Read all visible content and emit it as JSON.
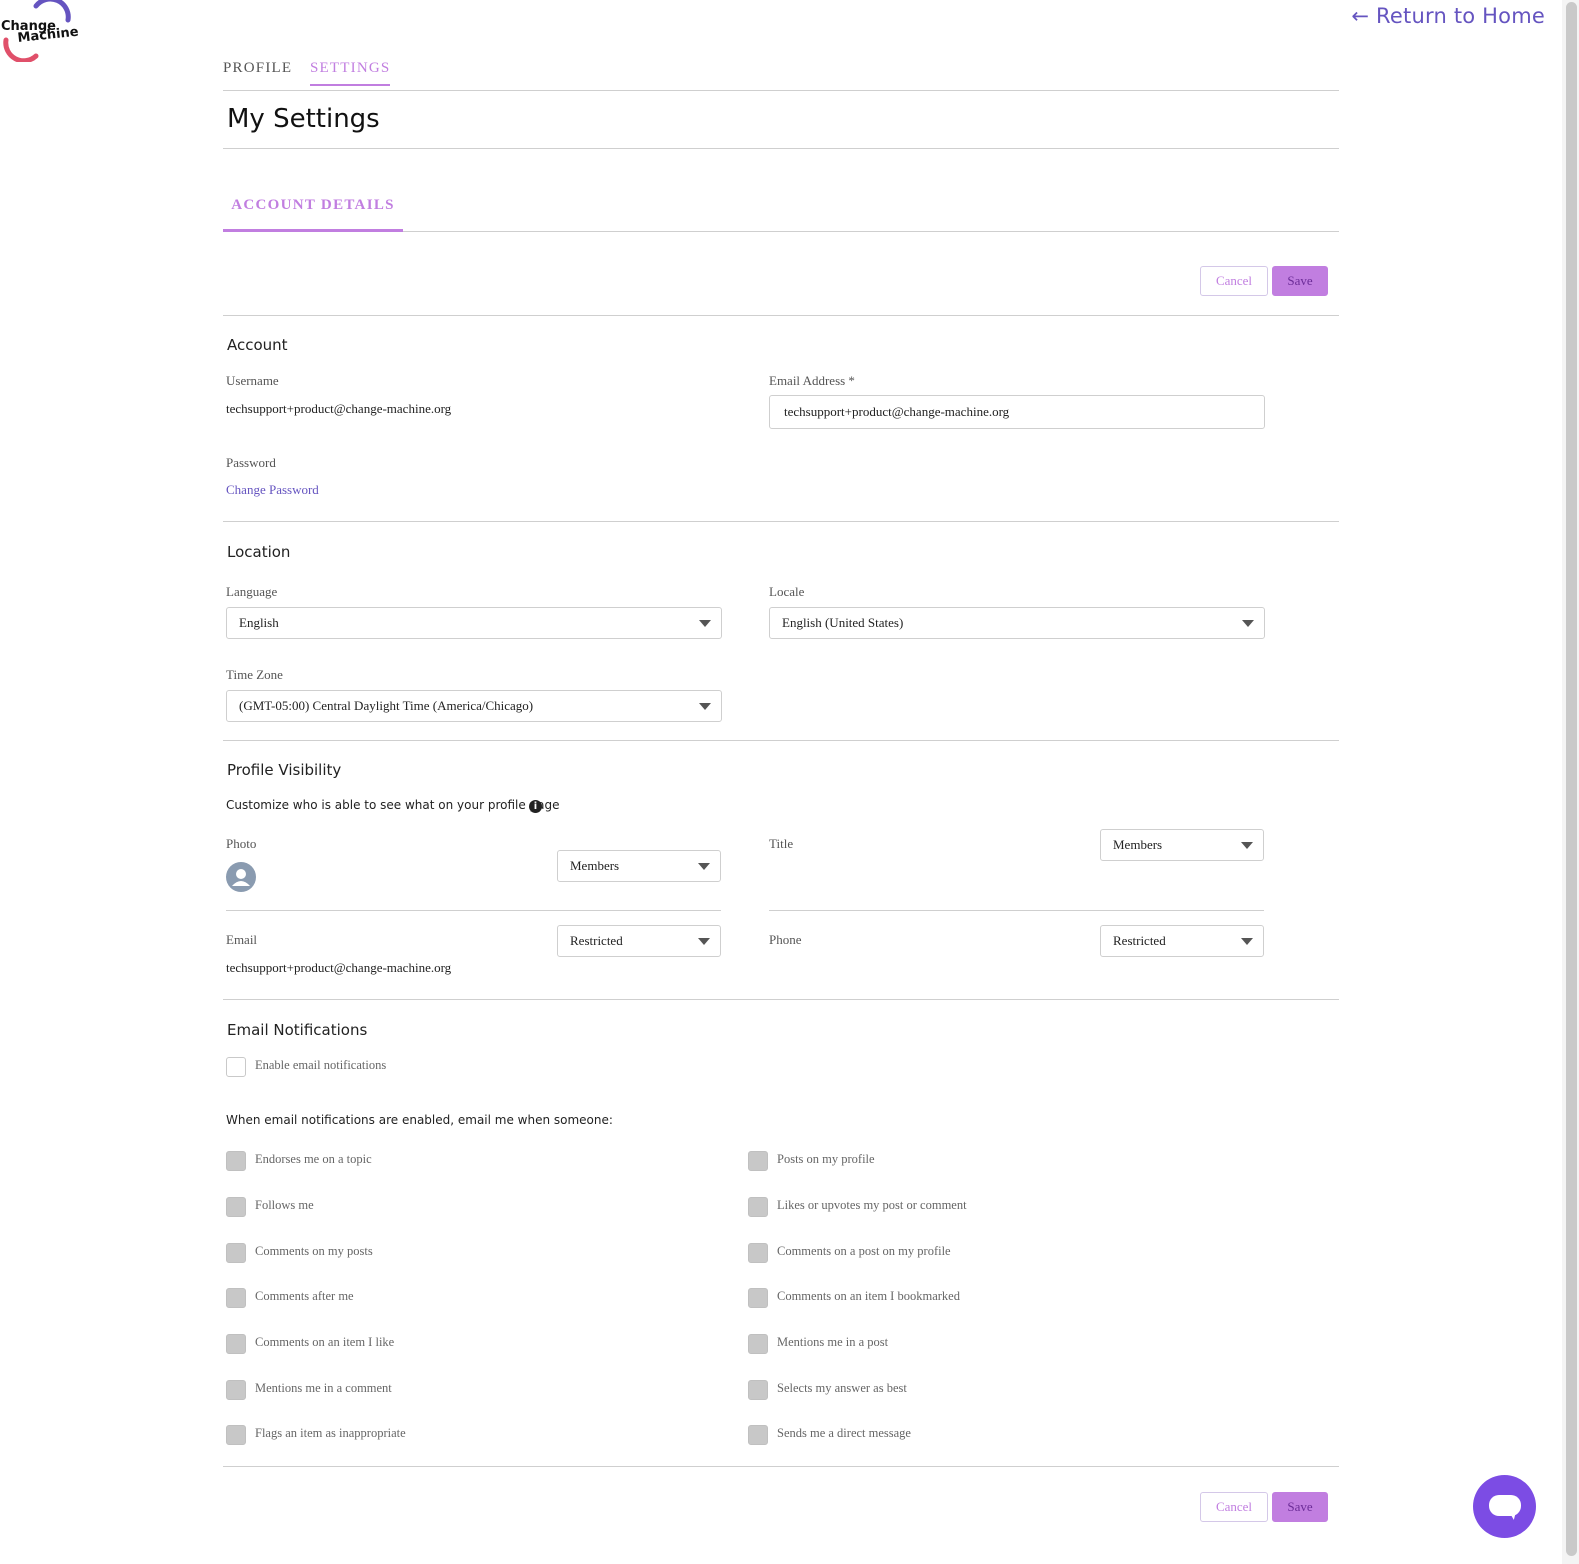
{
  "logo": {
    "line1": "Change",
    "line2": "Machine"
  },
  "header": {
    "return_link": "← Return to Home"
  },
  "tabs": [
    {
      "label": "PROFILE"
    },
    {
      "label": "SETTINGS"
    }
  ],
  "page_title": "My Settings",
  "subtab": "ACCOUNT DETAILS",
  "actions": {
    "cancel": "Cancel",
    "save": "Save"
  },
  "account": {
    "title": "Account",
    "username_label": "Username",
    "username_value": "techsupport+product@change-machine.org",
    "email_label": "Email Address *",
    "email_value": "techsupport+product@change-machine.org",
    "password_label": "Password",
    "change_password": "Change Password"
  },
  "location": {
    "title": "Location",
    "language_label": "Language",
    "language_value": "English",
    "locale_label": "Locale",
    "locale_value": "English (United States)",
    "timezone_label": "Time Zone",
    "timezone_value": "(GMT-05:00) Central Daylight Time (America/Chicago)"
  },
  "visibility": {
    "title": "Profile Visibility",
    "description": "Customize who is able to see what on your profile page",
    "photo_label": "Photo",
    "photo_value": "Members",
    "title_label": "Title",
    "title_value": "Members",
    "email_label": "Email",
    "email_text": "techsupport+product@change-machine.org",
    "email_value": "Restricted",
    "phone_label": "Phone",
    "phone_value": "Restricted"
  },
  "notifications": {
    "title": "Email Notifications",
    "enable_label": "Enable email notifications",
    "enabled": false,
    "intro": "When email notifications are enabled, email me when someone:",
    "left": [
      "Endorses me on a topic",
      "Follows me",
      "Comments on my posts",
      "Comments after me",
      "Comments on an item I like",
      "Mentions me in a comment",
      "Flags an item as inappropriate"
    ],
    "right": [
      "Posts on my profile",
      "Likes or upvotes my post or comment",
      "Comments on a post on my profile",
      "Comments on an item I bookmarked",
      "Mentions me in a post",
      "Selects my answer as best",
      "Sends me a direct message"
    ]
  },
  "colors": {
    "accent": "#c17ee0",
    "link": "#6554c0",
    "chat": "#7c4ce4"
  }
}
